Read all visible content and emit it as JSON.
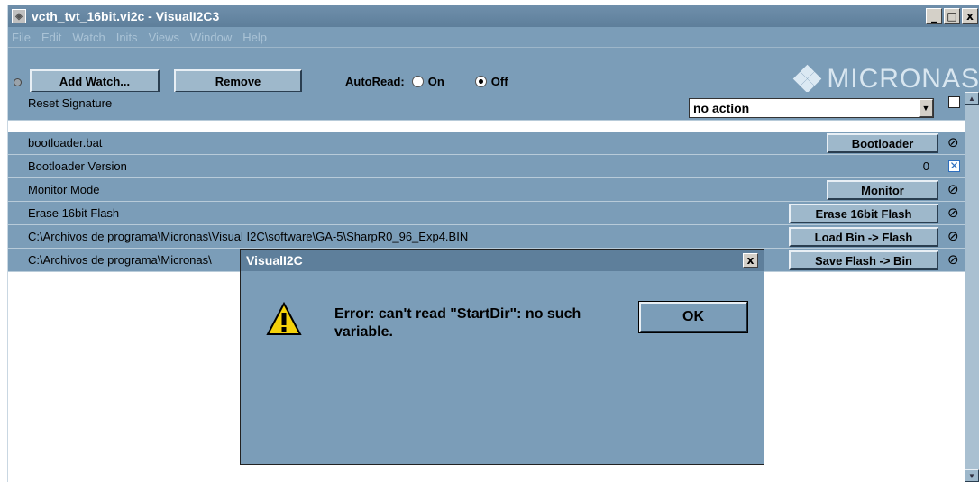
{
  "window": {
    "title": "vcth_tvt_16bit.vi2c - VisualI2C3"
  },
  "window_controls": {
    "minimize": "_",
    "maximize": "□",
    "close": "x"
  },
  "menu": [
    "File",
    "Edit",
    "Watch",
    "Inits",
    "Views",
    "Window",
    "Help"
  ],
  "toolbar": {
    "add_watch": "Add Watch...",
    "remove": "Remove",
    "autoread_label": "AutoRead:",
    "on_label": "On",
    "off_label": "Off",
    "autoread_selected": "Off",
    "logo": "MICRONAS"
  },
  "rows": [
    {
      "label": "Reset Signature",
      "select_value": "no action"
    },
    {
      "label": "bootloader.bat",
      "button": "Bootloader"
    },
    {
      "label": "Bootloader Version",
      "value": "0"
    },
    {
      "label": "Monitor Mode",
      "button": "Monitor"
    },
    {
      "label": "Erase 16bit Flash",
      "button": "Erase 16bit Flash"
    },
    {
      "label": "C:\\Archivos de programa\\Micronas\\Visual I2C\\software\\GA-5\\SharpR0_96_Exp4.BIN",
      "button": "Load Bin -> Flash"
    },
    {
      "label": "C:\\Archivos de programa\\Micronas\\",
      "button": "Save Flash -> Bin"
    }
  ],
  "dialog": {
    "title": "VisualI2C",
    "close": "x",
    "message": "Error: can't read \"StartDir\": no such variable.",
    "ok": "OK"
  },
  "colors": {
    "window_bg": "#7b9db8",
    "content_bg": "#ffffff",
    "title_bg": "#5e7f9b",
    "warning_yellow": "#f5d20a"
  }
}
